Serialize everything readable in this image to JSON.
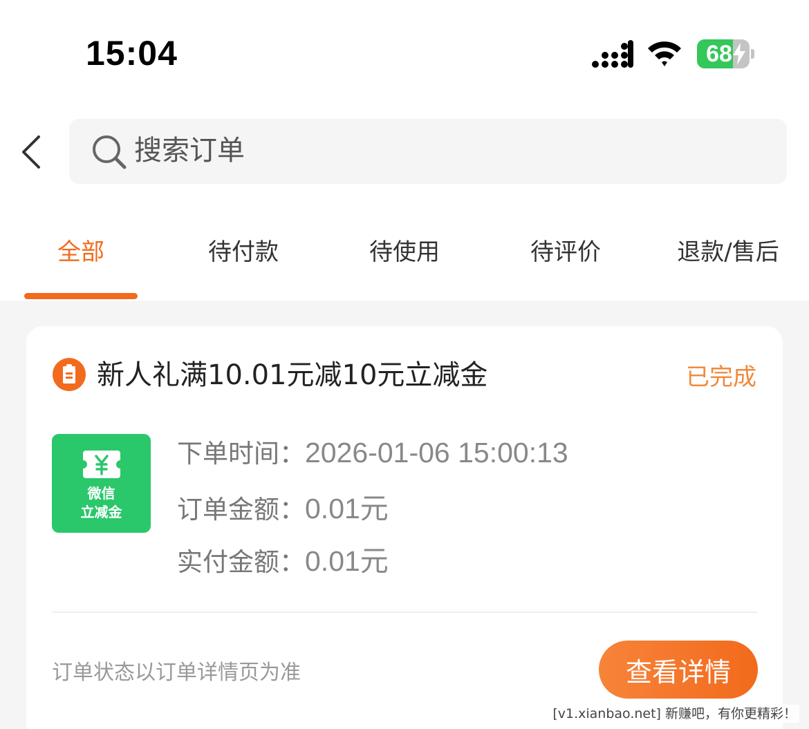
{
  "status_bar": {
    "time": "15:04",
    "battery": "68",
    "battery_level": 0.68
  },
  "search": {
    "placeholder": "搜索订单"
  },
  "tabs": [
    {
      "label": "全部",
      "active": true
    },
    {
      "label": "待付款",
      "active": false
    },
    {
      "label": "待使用",
      "active": false
    },
    {
      "label": "待评价",
      "active": false
    },
    {
      "label": "退款/售后",
      "active": false
    }
  ],
  "order": {
    "title": "新人礼满10.01元减10元立减金",
    "status": "已完成",
    "thumb_line1": "微信",
    "thumb_line2": "立减金",
    "order_time_label": "下单时间：",
    "order_time_value": "2026-01-06 15:00:13",
    "order_amount_label": "订单金额：",
    "order_amount_value": "0.01元",
    "paid_amount_label": "实付金额：",
    "paid_amount_value": "0.01元",
    "footer_note": "订单状态以订单详情页为准",
    "detail_button": "查看详情"
  },
  "watermark": "[v1.xianbao.net] 新赚吧，有你更精彩！",
  "colors": {
    "accent": "#f26b1d",
    "status": "#f08a3c",
    "voucher_green": "#2bc76b",
    "battery_green": "#34c759"
  }
}
